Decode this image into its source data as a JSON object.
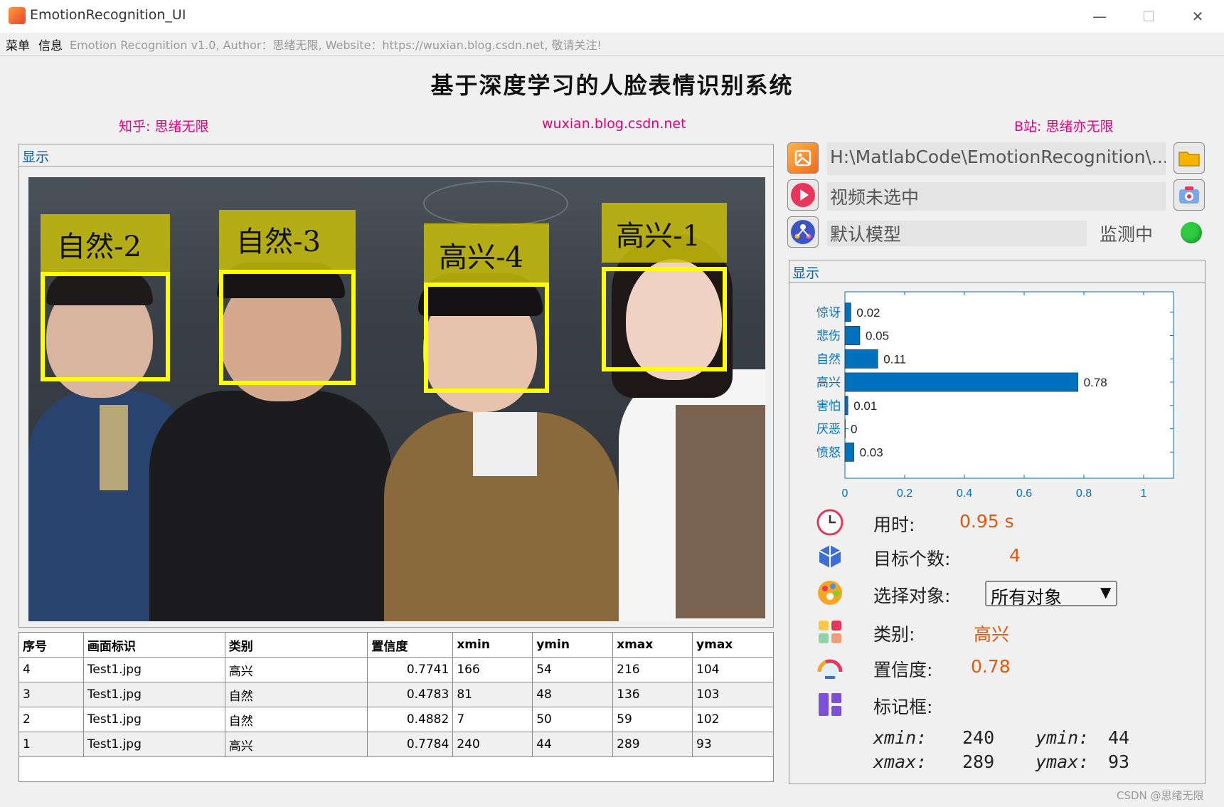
{
  "window": {
    "title": "EmotionRecognition_UI",
    "minimize": "—",
    "maximize": "☐",
    "close": "✕"
  },
  "menubar": {
    "menu": "菜单",
    "info": "信息",
    "info_text": "Emotion Recognition v1.0, Author：思绪无限, Website：https://wuxian.blog.csdn.net, 敬请关注!"
  },
  "header": {
    "title": "基于深度学习的人脸表情识别系统",
    "zhihu": "知乎: 思绪无限",
    "site": "wuxian.blog.csdn.net",
    "bilibili": "B站: 思绪亦无限"
  },
  "left_panel": {
    "title": "显示"
  },
  "detections_image": {
    "labels": [
      "自然-2",
      "自然-3",
      "高兴-4",
      "高兴-1"
    ]
  },
  "table": {
    "headers": [
      "序号",
      "画面标识",
      "类别",
      "置信度",
      "xmin",
      "ymin",
      "xmax",
      "ymax"
    ],
    "rows": [
      [
        "4",
        "Test1.jpg",
        "高兴",
        "0.7741",
        "166",
        "54",
        "216",
        "104"
      ],
      [
        "3",
        "Test1.jpg",
        "自然",
        "0.4783",
        "81",
        "48",
        "136",
        "103"
      ],
      [
        "2",
        "Test1.jpg",
        "自然",
        "0.4882",
        "7",
        "50",
        "59",
        "102"
      ],
      [
        "1",
        "Test1.jpg",
        "高兴",
        "0.7784",
        "240",
        "44",
        "289",
        "93"
      ]
    ]
  },
  "controls": {
    "image_path": "H:\\MatlabCode\\EmotionRecognition\\...",
    "video_status": "视频未选中",
    "model": "默认模型",
    "monitor_label": "监测中",
    "monitor_color": "#2ecc40"
  },
  "right_panel": {
    "title": "显示"
  },
  "chart_data": {
    "type": "bar",
    "orientation": "horizontal",
    "categories": [
      "惊讶",
      "悲伤",
      "自然",
      "高兴",
      "害怕",
      "厌恶",
      "愤怒"
    ],
    "values": [
      0.02,
      0.05,
      0.11,
      0.78,
      0.01,
      0,
      0.03
    ],
    "value_labels": [
      "0.02",
      "0.05",
      "0.11",
      "0.78",
      "0.01",
      "0",
      "0.03"
    ],
    "xlim": [
      0,
      1.1
    ],
    "xticks": [
      "0",
      "0.2",
      "0.4",
      "0.6",
      "0.8",
      "1"
    ],
    "xtick_values": [
      0,
      0.2,
      0.4,
      0.6,
      0.8,
      1
    ],
    "bar_color": "#0072bd",
    "axis_color": "#0072bd"
  },
  "stats": {
    "time_label": "用时:",
    "time_value": "0.95 s",
    "count_label": "目标个数:",
    "count_value": "4",
    "select_label": "选择对象:",
    "select_value": "所有对象",
    "class_label": "类别:",
    "class_value": "高兴",
    "conf_label": "置信度:",
    "conf_value": "0.78",
    "bbox_label": "标记框:",
    "xmin_label": "xmin:",
    "xmin": "240",
    "ymin_label": "ymin:",
    "ymin": "44",
    "xmax_label": "xmax:",
    "xmax": "289",
    "ymax_label": "ymax:",
    "ymax": "93"
  },
  "watermark": "CSDN @思绪无限"
}
